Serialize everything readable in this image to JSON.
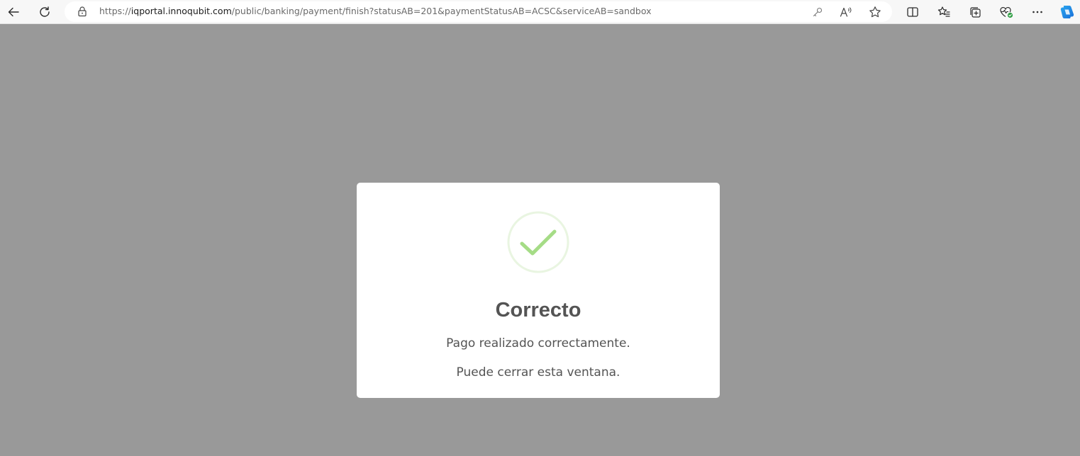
{
  "browser": {
    "url_prefix": "https://",
    "url_domain": "iqportal.innoqubit.com",
    "url_path": "/public/banking/payment/finish?statusAB=201&paymentStatusAB=ACSC&serviceAB=sandbox",
    "icons": {
      "back": "back-arrow-icon",
      "refresh": "refresh-icon",
      "lock": "lock-icon",
      "key": "key-icon",
      "read_aloud": "read-aloud-icon",
      "favorite": "star-icon",
      "split_screen": "split-screen-icon",
      "favorites": "favorites-icon",
      "collections": "collections-icon",
      "browser_essentials": "heart-pulse-icon",
      "more": "more-icon",
      "copilot": "copilot-icon"
    }
  },
  "modal": {
    "title": "Correcto",
    "message": "Pago realizado correctamente.",
    "note": "Puede cerrar esta ventana.",
    "icon": "success-check-icon"
  },
  "colors": {
    "overlay": "#999999",
    "check": "#a5dc86",
    "check_ring": "#e9f5e1",
    "text": "#545454"
  }
}
